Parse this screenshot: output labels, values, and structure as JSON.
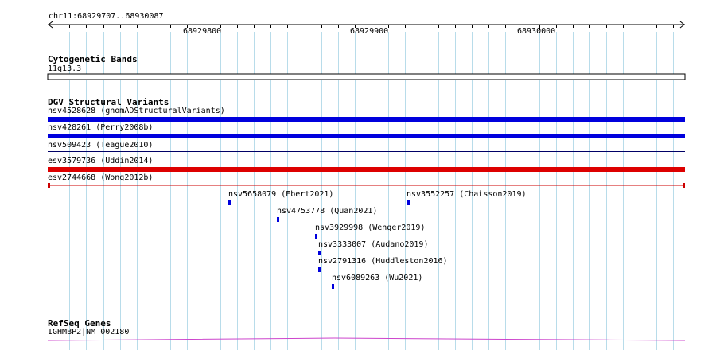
{
  "coordinate_range": "chr11:68929707..68930087",
  "ruler": {
    "ticks": [
      {
        "label": "68929800",
        "pos": 68929800
      },
      {
        "label": "68929900",
        "pos": 68929900
      },
      {
        "label": "68930000",
        "pos": 68930000
      }
    ]
  },
  "cytoband_track": {
    "title": "Cytogenetic Bands",
    "band": "11q13.3"
  },
  "dgv_track": {
    "title": "DGV Structural Variants",
    "features": [
      {
        "label": "nsv4528628 (gnomADStructuralVariants)",
        "color": "#0000dd"
      },
      {
        "label": "nsv428261 (Perry2008b)",
        "color": "#0000dd"
      },
      {
        "label": "nsv509423 (Teague2010)",
        "color": "#000066"
      },
      {
        "label": "esv3579736 (Uddin2014)",
        "color": "#dd0000"
      },
      {
        "label": "esv2744668 (Wong2012b)",
        "color": "#cc0000"
      }
    ],
    "small_features": [
      {
        "label": "nsv5658079 (Ebert2021)",
        "color": "#0000dd"
      },
      {
        "label": "nsv3552257 (Chaisson2019)",
        "color": "#0000dd"
      },
      {
        "label": "nsv4753778 (Quan2021)",
        "color": "#0000dd"
      },
      {
        "label": "nsv3929998 (Wenger2019)",
        "color": "#0000dd"
      },
      {
        "label": "nsv3333007 (Audano2019)",
        "color": "#0000dd"
      },
      {
        "label": "nsv2791316 (Huddleston2016)",
        "color": "#0000dd"
      },
      {
        "label": "nsv6089263 (Wu2021)",
        "color": "#0000dd"
      }
    ]
  },
  "refseq_track": {
    "title": "RefSeq Genes",
    "gene": "IGHMBP2|NM_002180",
    "color": "#cc44cc"
  },
  "colors": {
    "grid": "#b8dcea",
    "axis": "#000000"
  }
}
